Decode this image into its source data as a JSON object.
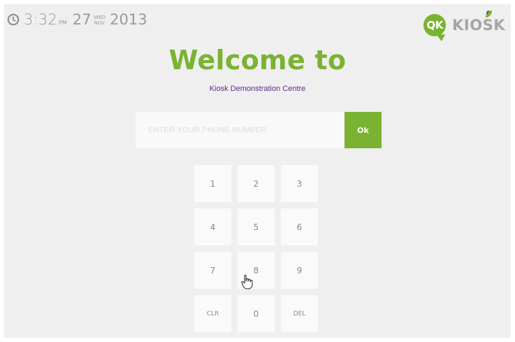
{
  "status_bar": {
    "time": "3:32",
    "ampm": "PM",
    "day": "27",
    "weekday": "WED",
    "month": "NOV",
    "year": "2013",
    "clock_icon": "clock-icon"
  },
  "logo": {
    "badge_text": "QK",
    "word": "KIOSK",
    "accent_color": "#7ab331"
  },
  "header": {
    "title": "Welcome to",
    "subtitle": "Kiosk Demonstration Centre"
  },
  "phone": {
    "placeholder": "ENTER YOUR PHONE NUMBER",
    "value": "",
    "ok_label": "Ok"
  },
  "keypad": {
    "keys": [
      "1",
      "2",
      "3",
      "4",
      "5",
      "6",
      "7",
      "8",
      "9",
      "CLR",
      "0",
      "DEL"
    ]
  },
  "colors": {
    "accent": "#7ab331",
    "subtitle": "#5a2a8a",
    "background": "#efefef",
    "key_background": "#fafafa"
  },
  "cursor_icon": "hand-pointer-icon"
}
